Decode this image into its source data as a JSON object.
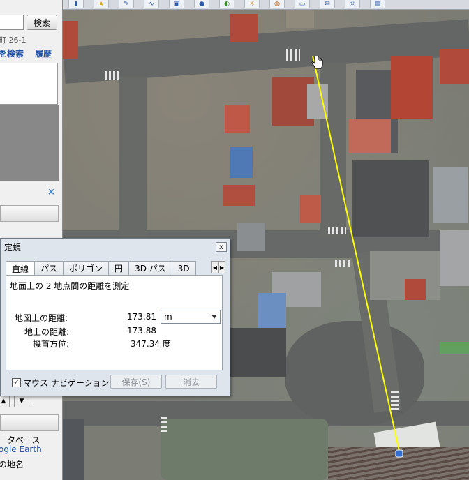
{
  "search": {
    "button_label": "検索",
    "address_text": "町 26-1",
    "route_search_label": "を検索",
    "history_label": "履歴"
  },
  "sidebar": {
    "close_icon": "×",
    "up_icon": "▲",
    "down_icon": "▼",
    "layer_database": "ータベース",
    "layer_google_earth": "ogle Earth",
    "layer_place_names": "の地名"
  },
  "ruler": {
    "title": "定規",
    "close_icon": "x",
    "tabs": [
      "直線",
      "パス",
      "ポリゴン",
      "円",
      "3D パス",
      "3D"
    ],
    "active_tab": "直線",
    "description": "地面上の 2 地点間の距離を測定",
    "map_distance_label": "地図上の距離:",
    "map_distance_value": "173.81",
    "unit": "m",
    "ground_distance_label": "地上の距離:",
    "ground_distance_value": "173.88",
    "heading_label": "機首方位:",
    "heading_value": "347.34 度",
    "mouse_nav_label": "マウス ナビゲーション",
    "mouse_nav_checked": true,
    "save_label": "保存(S)",
    "clear_label": "消去"
  },
  "measure_line": {
    "color": "#ffff00",
    "end_marker_color": "#2f6fd6"
  }
}
